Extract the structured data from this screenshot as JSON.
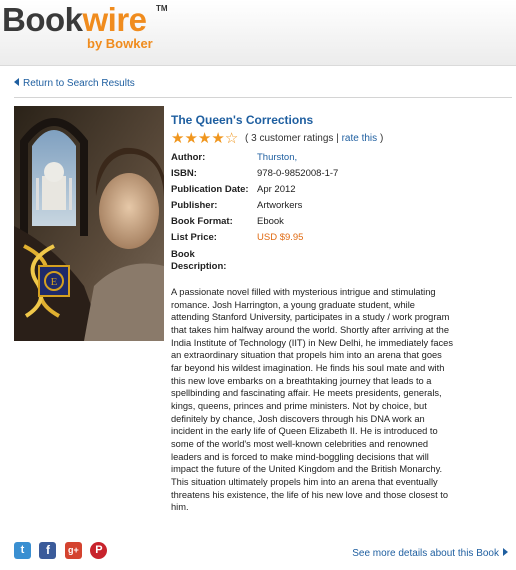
{
  "brand": {
    "name_part1": "Book",
    "name_part2": "wire",
    "trademark": "TM",
    "byline": "by Bowker",
    "color_dark": "#3a3a3a",
    "color_accent": "#f08c1e"
  },
  "navigation": {
    "back_label": "Return to Search Results"
  },
  "book": {
    "title": "The Queen's Corrections",
    "rating": {
      "stars": 4,
      "max": 5,
      "count_text": "( 3 customer ratings |",
      "rate_link": "rate this",
      "close": ")"
    },
    "details": [
      {
        "label": "Author:",
        "value": "Thurston,"
      },
      {
        "label": "ISBN:",
        "value": "978-0-9852008-1-7"
      },
      {
        "label": "Publication Date:",
        "value": "Apr 2012"
      },
      {
        "label": "Publisher:",
        "value": "Artworkers"
      },
      {
        "label": "Book Format:",
        "value": "Ebook"
      },
      {
        "label": "List Price:",
        "value": "USD $9.95"
      },
      {
        "label": "Book Description:",
        "value": ""
      }
    ],
    "description": "A passionate novel filled with mysterious intrigue and stimulating romance. Josh Harrington, a young graduate student, while attending Stanford University, participates in a study / work program that takes him halfway around the world. Shortly after arriving at the India Institute of Technology (IIT) in New Delhi, he immediately faces an extraordinary situation that propels him into an arena that goes far beyond his wildest imagination. He finds his soul mate and with this new love embarks on a breathtaking journey that leads to a spellbinding and fascinating affair. He meets presidents, generals, kings, queens, princes and prime ministers. Not by choice, but definitely by chance, Josh discovers through his DNA work an incident in the early life of Queen Elizabeth II. He is introduced to some of the world's most well-known celebrities and renowned leaders and is forced to make mind-boggling decisions that will impact the future of the United Kingdom and the British Monarchy. This situation ultimately propels him into an arena that eventually threatens his existence, the life of his new love and those closest to him."
  },
  "social": [
    {
      "name": "twitter-icon",
      "glyph": "t"
    },
    {
      "name": "facebook-icon",
      "glyph": "f"
    },
    {
      "name": "google-plus-icon",
      "glyph": "g+"
    },
    {
      "name": "pinterest-icon",
      "glyph": "P"
    }
  ],
  "footer": {
    "more_label": "See more details about this Book"
  },
  "colors": {
    "link": "#1f5fa0",
    "price": "#e06a12",
    "star": "#f0961e"
  }
}
